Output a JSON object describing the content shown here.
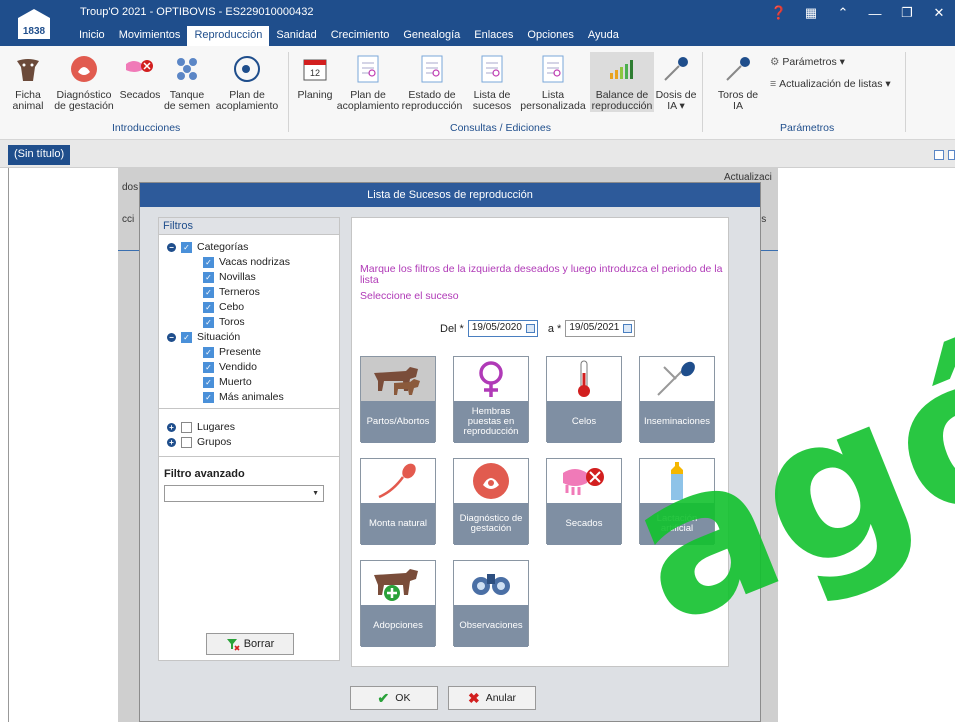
{
  "app": {
    "logo_text": "1838",
    "title": "Troup'O 2021 - OPTIBOVIS - ES229010000432"
  },
  "menu": [
    "Inicio",
    "Movimientos",
    "Reproducción",
    "Sanidad",
    "Crecimiento",
    "Genealogía",
    "Enlaces",
    "Opciones",
    "Ayuda"
  ],
  "ribbon": {
    "buttons": [
      {
        "label": "Ficha\nanimal",
        "icon": "cow-icon"
      },
      {
        "label": "Diagnóstico\nde gestación",
        "icon": "pregnancy-icon"
      },
      {
        "label": "Secados",
        "icon": "udder-icon"
      },
      {
        "label": "Tanque\nde semen",
        "icon": "semen-tank-icon"
      },
      {
        "label": "Plan de\nacoplamiento",
        "icon": "mating-plan-icon"
      },
      {
        "label": "Planing",
        "icon": "calendar-icon",
        "badge": "12"
      },
      {
        "label": "Plan de\nacoplamiento",
        "icon": "mating-plan-doc-icon"
      },
      {
        "label": "Estado de\nreproducción",
        "icon": "repro-status-icon"
      },
      {
        "label": "Lista de\nsucesos",
        "icon": "events-list-icon"
      },
      {
        "label": "Lista\npersonalizada",
        "icon": "custom-list-icon"
      },
      {
        "label": "Balance de\nreproducción",
        "icon": "bar-chart-icon"
      },
      {
        "label": "Dosis de\nIA ▾",
        "icon": "ai-dose-icon"
      },
      {
        "label": "Toros de\nIA",
        "icon": "ai-bulls-icon"
      }
    ],
    "parametros": "Parámetros ▾",
    "actualizacion": "Actualización de listas ▾",
    "groups": {
      "introducciones": "Introducciones",
      "consultas": "Consultas / Ediciones",
      "parametros": "Parámetros"
    }
  },
  "tab": {
    "title": "(Sin título)"
  },
  "background": {
    "text_dos": "dos",
    "text_cci": "cci",
    "text_actualiz": "Actualizaci",
    "text_etros": "etros"
  },
  "dialog": {
    "title": "Lista de Sucesos de reproducción",
    "filters": {
      "header": "Filtros",
      "categorias": "Categorías",
      "items_cat": [
        "Vacas nodrizas",
        "Novillas",
        "Terneros",
        "Cebo",
        "Toros"
      ],
      "situacion": "Situación",
      "items_sit": [
        "Presente",
        "Vendido",
        "Muerto",
        "Más animales"
      ],
      "lugares": "Lugares",
      "grupos": "Grupos",
      "advanced_label": "Filtro avanzado",
      "advanced_value": "",
      "clear_button": "Borrar"
    },
    "instruction": "Marque los filtros de la izquierda deseados y luego introduzca el periodo de la lista",
    "select_event": "Seleccione el suceso",
    "date_from_label": "Del *",
    "date_from": "19/05/2020",
    "date_to_label": "a *",
    "date_to": "19/05/2021",
    "events": [
      {
        "label": "Partos/Abortos",
        "icon": "calving-icon"
      },
      {
        "label": "Hembras puestas en reproducción",
        "icon": "female-symbol-icon"
      },
      {
        "label": "Celos",
        "icon": "thermometer-icon"
      },
      {
        "label": "Inseminaciones",
        "icon": "insemination-icon"
      },
      {
        "label": "Monta natural",
        "icon": "sperm-icon"
      },
      {
        "label": "Diagnóstico de gestación",
        "icon": "pregnancy-icon"
      },
      {
        "label": "Secados",
        "icon": "udder-stop-icon"
      },
      {
        "label": "Lactación artificial",
        "icon": "bottle-icon"
      },
      {
        "label": "Adopciones",
        "icon": "cow-add-icon"
      },
      {
        "label": "Observaciones",
        "icon": "binoculars-icon"
      }
    ],
    "ok_button": "OK",
    "cancel_button": "Anular"
  },
  "watermark": {
    "text": "agó"
  },
  "colors": {
    "titlebar": "#1f4e8c",
    "accent_purple": "#b03ab7",
    "tile_label_bg": "#7f8fa3",
    "watermark": "#12c22e"
  }
}
